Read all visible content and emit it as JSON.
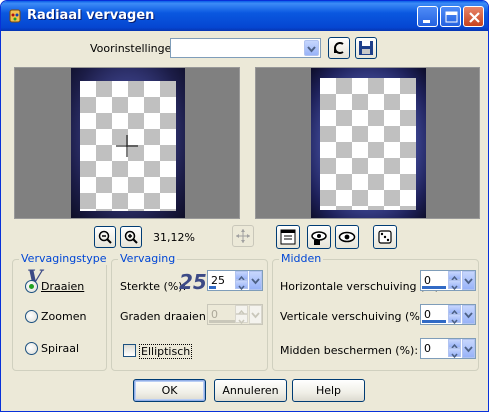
{
  "window": {
    "title": "Radiaal vervagen"
  },
  "presets": {
    "label": "Voorinstellingen:",
    "value": ""
  },
  "zoom": {
    "level": "31,12%"
  },
  "blur_type": {
    "title": "Vervagingstype",
    "options": [
      {
        "label": "Draaien",
        "selected": true
      },
      {
        "label": "Zoomen",
        "selected": false
      },
      {
        "label": "Spiraal",
        "selected": false
      }
    ]
  },
  "blur": {
    "title": "Vervaging",
    "strength_label": "Sterkte (%):",
    "strength_value": "25",
    "strength_big": "25",
    "rotate_label": "Graden draaien:",
    "rotate_value": "0",
    "elliptical_label": "Elliptisch",
    "elliptical_checked": false
  },
  "center": {
    "title": "Midden",
    "h_offset_label": "Horizontale verschuiving (%):",
    "h_offset_value": "0",
    "v_offset_label": "Verticale verschuiving (%):",
    "v_offset_value": "0",
    "protect_label": "Midden beschermen (%):",
    "protect_value": "0"
  },
  "buttons": {
    "ok": "OK",
    "cancel": "Annuleren",
    "help": "Help"
  },
  "colors": {
    "titlebar": "#0a58e0",
    "group_title": "#0046d5",
    "face": "#ece9d8"
  }
}
